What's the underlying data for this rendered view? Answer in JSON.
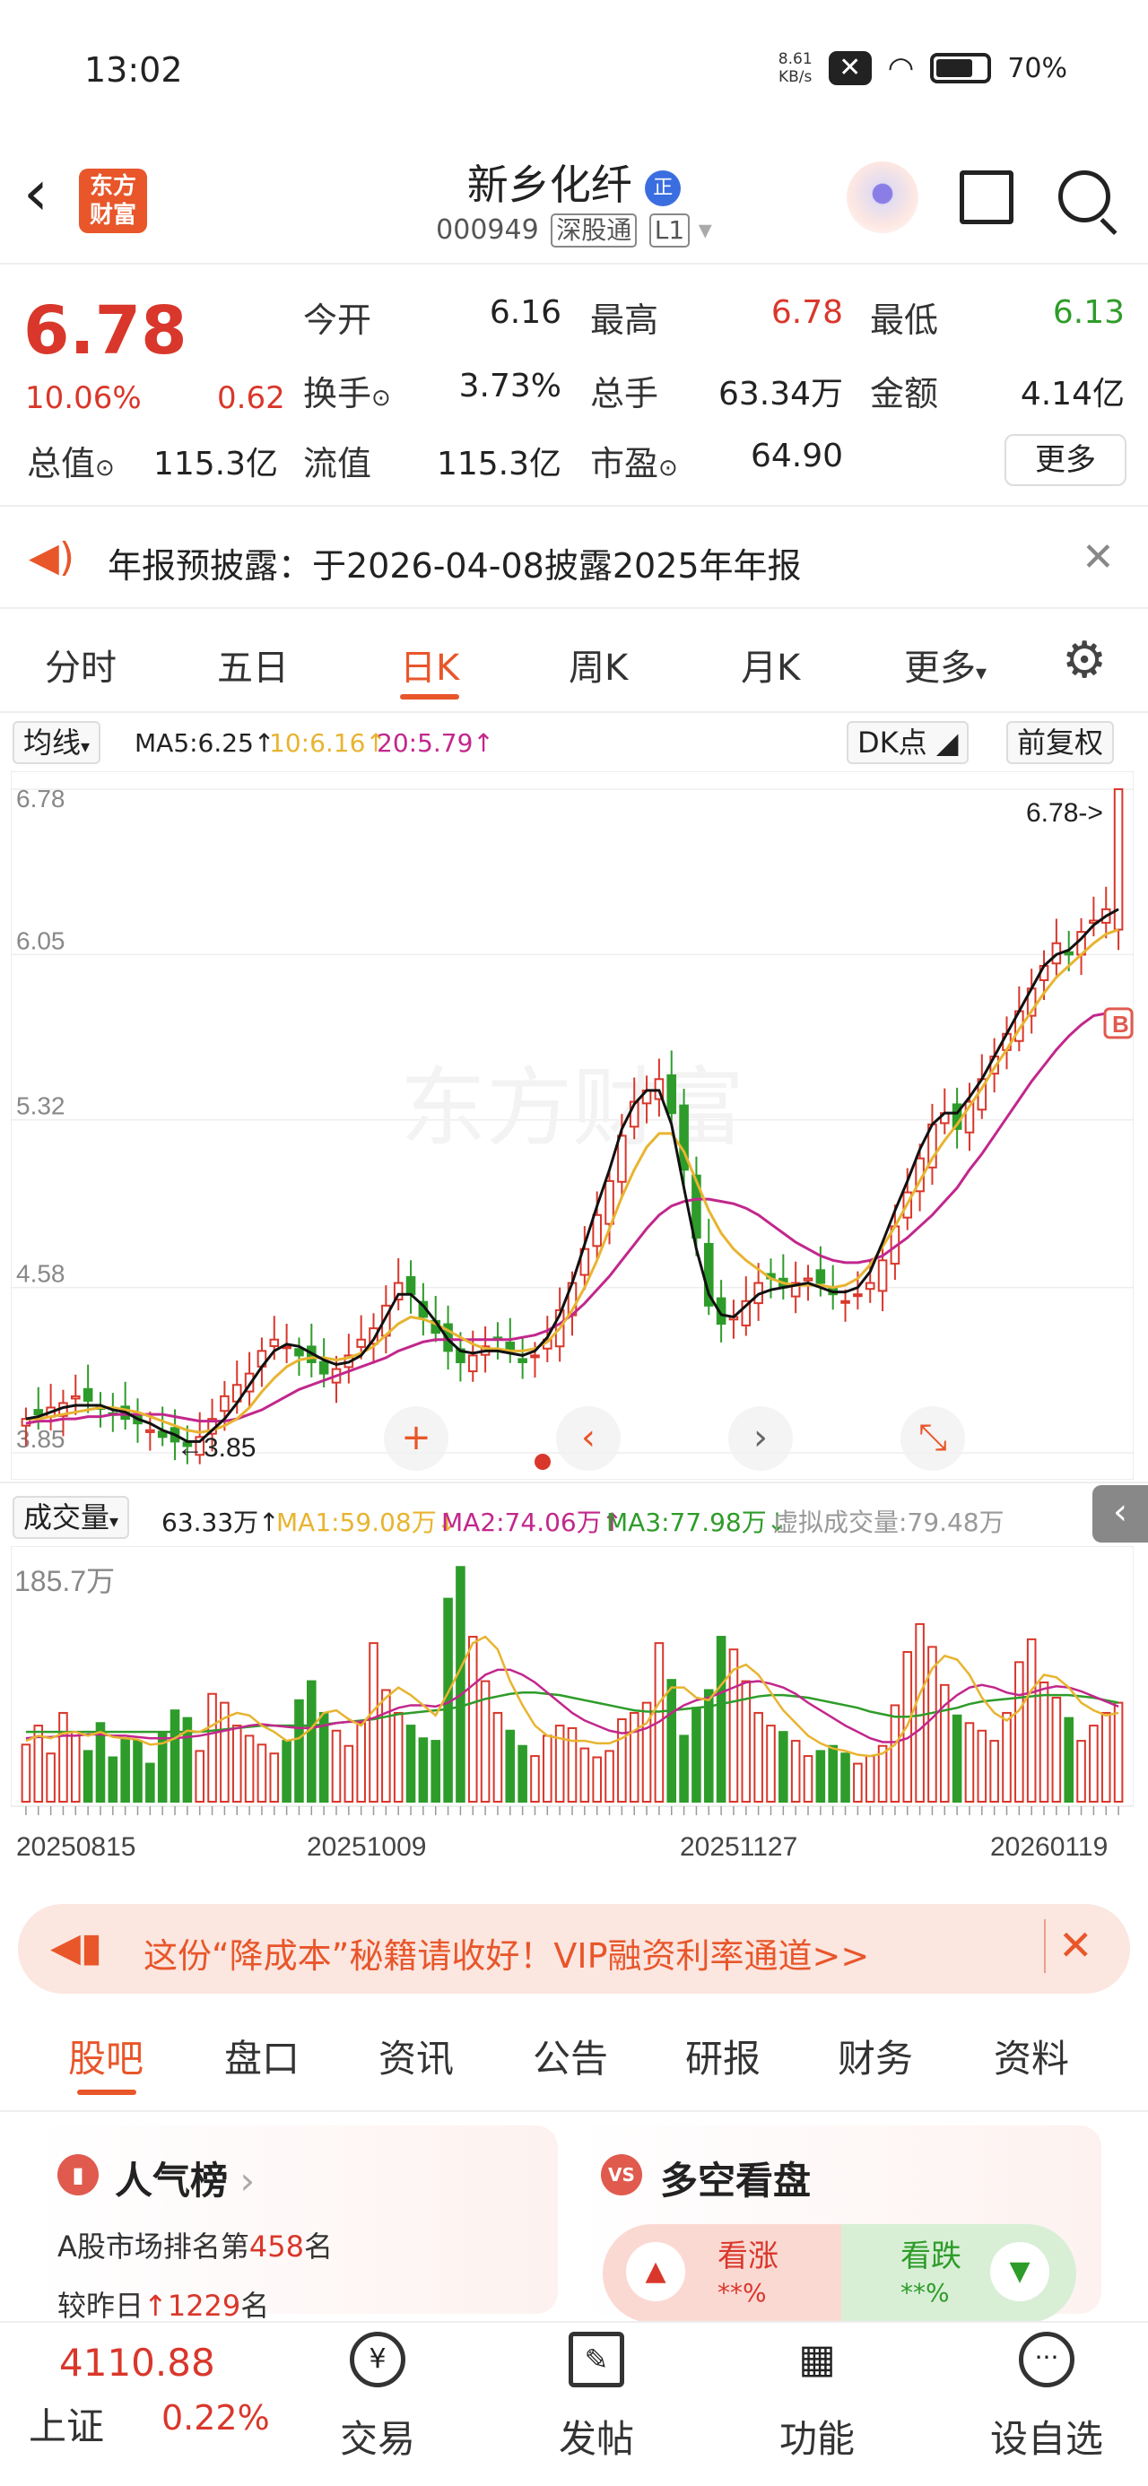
{
  "status_bar": {
    "time": "13:02",
    "net_speed": "8.61",
    "net_unit": "KB/s",
    "battery": "70%"
  },
  "header": {
    "logo": "东方财富",
    "name": "新乡化纤",
    "code": "000949",
    "tag1": "深股通",
    "tag2": "L1",
    "badge": "正"
  },
  "quote": {
    "price": "6.78",
    "pct": "10.06%",
    "change": "0.62",
    "open_label": "今开",
    "open": "6.16",
    "high_label": "最高",
    "high": "6.78",
    "low_label": "最低",
    "low": "6.13",
    "turnover_label": "换手",
    "turnover": "3.73%",
    "volume_label": "总手",
    "volume": "63.34万",
    "amount_label": "金额",
    "amount": "4.14亿",
    "mcap_label": "总值",
    "mcap": "115.3亿",
    "float_label": "流值",
    "float": "115.3亿",
    "pe_label": "市盈",
    "pe": "64.90",
    "more": "更多"
  },
  "notice": {
    "text": "年报预披露：于2026-04-08披露2025年年报"
  },
  "chart_tabs": [
    "分时",
    "五日",
    "日K",
    "周K",
    "月K",
    "更多"
  ],
  "ma_row": {
    "selector": "均线",
    "ma5": "MA5:6.25↑",
    "ma10": "10:6.16↑",
    "ma20": "20:5.79↑",
    "dk": "DK点",
    "adjust": "前复权"
  },
  "chart_data": {
    "type": "candlestick",
    "y_ticks": [
      "6.78",
      "6.05",
      "5.32",
      "4.58",
      "3.85"
    ],
    "ylim": [
      3.85,
      6.78
    ],
    "last_label": "6.78",
    "low_label": "3.85",
    "x_labels": [
      "20250815",
      "20251009",
      "20251127",
      "20260119"
    ],
    "closes": [
      4.0,
      4.02,
      4.05,
      4.07,
      4.1,
      4.08,
      4.05,
      4.02,
      4.0,
      3.98,
      3.95,
      3.92,
      3.9,
      3.88,
      3.92,
      4.0,
      4.1,
      4.15,
      4.2,
      4.3,
      4.35,
      4.32,
      4.28,
      4.25,
      4.2,
      4.22,
      4.28,
      4.35,
      4.4,
      4.5,
      4.6,
      4.55,
      4.45,
      4.38,
      4.3,
      4.25,
      4.28,
      4.32,
      4.35,
      4.3,
      4.25,
      4.28,
      4.35,
      4.48,
      4.6,
      4.75,
      4.9,
      5.05,
      5.25,
      5.4,
      5.45,
      5.5,
      5.35,
      5.1,
      4.8,
      4.5,
      4.42,
      4.45,
      4.52,
      4.6,
      4.62,
      4.58,
      4.6,
      4.62,
      4.6,
      4.55,
      4.52,
      4.55,
      4.6,
      4.7,
      4.85,
      5.0,
      5.15,
      5.3,
      5.35,
      5.28,
      5.4,
      5.5,
      5.6,
      5.7,
      5.8,
      5.9,
      6.0,
      6.1,
      6.05,
      6.15,
      6.2,
      6.25,
      6.78
    ],
    "ma5": [
      4.0,
      4.01,
      4.03,
      4.05,
      4.06,
      4.06,
      4.06,
      4.04,
      4.03,
      4.0,
      3.98,
      3.95,
      3.93,
      3.9,
      3.9,
      3.95,
      4.0,
      4.07,
      4.15,
      4.23,
      4.3,
      4.33,
      4.32,
      4.29,
      4.26,
      4.24,
      4.25,
      4.28,
      4.35,
      4.45,
      4.55,
      4.55,
      4.5,
      4.43,
      4.35,
      4.3,
      4.29,
      4.3,
      4.3,
      4.29,
      4.28,
      4.3,
      4.36,
      4.46,
      4.6,
      4.77,
      4.94,
      5.1,
      5.28,
      5.39,
      5.45,
      5.45,
      5.3,
      5.02,
      4.75,
      4.55,
      4.46,
      4.45,
      4.5,
      4.55,
      4.57,
      4.58,
      4.59,
      4.6,
      4.58,
      4.56,
      4.56,
      4.58,
      4.65,
      4.78,
      4.92,
      5.05,
      5.19,
      5.3,
      5.35,
      5.35,
      5.42,
      5.5,
      5.6,
      5.7,
      5.8,
      5.9,
      6.0,
      6.05,
      6.07,
      6.12,
      6.18,
      6.22,
      6.25
    ],
    "ma10": [
      4.0,
      4.0,
      4.01,
      4.02,
      4.03,
      4.04,
      4.05,
      4.05,
      4.04,
      4.03,
      4.01,
      3.99,
      3.97,
      3.95,
      3.94,
      3.95,
      3.97,
      4.0,
      4.05,
      4.12,
      4.18,
      4.23,
      4.26,
      4.27,
      4.27,
      4.26,
      4.27,
      4.29,
      4.32,
      4.37,
      4.42,
      4.45,
      4.44,
      4.42,
      4.39,
      4.36,
      4.33,
      4.31,
      4.31,
      4.3,
      4.3,
      4.31,
      4.34,
      4.4,
      4.48,
      4.58,
      4.7,
      4.84,
      4.98,
      5.1,
      5.2,
      5.26,
      5.26,
      5.18,
      5.05,
      4.92,
      4.82,
      4.75,
      4.7,
      4.66,
      4.62,
      4.6,
      4.59,
      4.59,
      4.59,
      4.58,
      4.59,
      4.62,
      4.68,
      4.76,
      4.85,
      4.95,
      5.05,
      5.15,
      5.23,
      5.3,
      5.38,
      5.46,
      5.55,
      5.63,
      5.72,
      5.8,
      5.88,
      5.95,
      6.0,
      6.05,
      6.1,
      6.14,
      6.16
    ],
    "ma20": [
      3.98,
      3.99,
      3.99,
      4.0,
      4.0,
      4.01,
      4.01,
      4.02,
      4.02,
      4.02,
      4.02,
      4.02,
      4.01,
      4.0,
      3.99,
      3.99,
      3.99,
      4.0,
      4.02,
      4.04,
      4.07,
      4.1,
      4.13,
      4.15,
      4.17,
      4.19,
      4.21,
      4.23,
      4.25,
      4.27,
      4.3,
      4.32,
      4.34,
      4.35,
      4.35,
      4.35,
      4.35,
      4.35,
      4.35,
      4.35,
      4.36,
      4.37,
      4.39,
      4.42,
      4.46,
      4.51,
      4.57,
      4.63,
      4.7,
      4.77,
      4.84,
      4.9,
      4.94,
      4.96,
      4.97,
      4.97,
      4.96,
      4.95,
      4.93,
      4.9,
      4.86,
      4.82,
      4.78,
      4.75,
      4.72,
      4.7,
      4.69,
      4.69,
      4.7,
      4.72,
      4.76,
      4.8,
      4.85,
      4.9,
      4.96,
      5.02,
      5.1,
      5.17,
      5.25,
      5.33,
      5.41,
      5.49,
      5.56,
      5.63,
      5.69,
      5.74,
      5.78,
      5.79,
      5.79
    ],
    "vol_max_label": "185.7万",
    "volumes": [
      45,
      60,
      38,
      70,
      55,
      40,
      62,
      35,
      50,
      48,
      30,
      55,
      72,
      66,
      40,
      85,
      78,
      60,
      52,
      45,
      38,
      48,
      80,
      95,
      70,
      56,
      44,
      62,
      125,
      88,
      70,
      60,
      50,
      48,
      160,
      185,
      130,
      95,
      70,
      56,
      44,
      36,
      52,
      60,
      58,
      42,
      35,
      40,
      65,
      70,
      78,
      125,
      96,
      52,
      74,
      88,
      130,
      120,
      95,
      70,
      60,
      55,
      48,
      36,
      40,
      44,
      38,
      30,
      36,
      44,
      76,
      118,
      140,
      122,
      92,
      68,
      62,
      56,
      48,
      70,
      110,
      128,
      94,
      82,
      66,
      48,
      60,
      70,
      78
    ],
    "vol_ma1": [
      48,
      52,
      50,
      54,
      55,
      52,
      55,
      51,
      50,
      49,
      45,
      46,
      50,
      56,
      55,
      60,
      66,
      70,
      68,
      60,
      55,
      48,
      50,
      58,
      70,
      72,
      65,
      60,
      72,
      82,
      90,
      84,
      76,
      68,
      86,
      105,
      125,
      130,
      120,
      95,
      76,
      60,
      52,
      50,
      48,
      48,
      46,
      46,
      50,
      56,
      62,
      78,
      90,
      90,
      82,
      80,
      92,
      104,
      108,
      100,
      86,
      72,
      62,
      52,
      46,
      42,
      40,
      37,
      36,
      38,
      45,
      60,
      85,
      105,
      115,
      112,
      100,
      82,
      70,
      64,
      72,
      88,
      100,
      98,
      90,
      78,
      72,
      68,
      70
    ],
    "vol_ma2": [
      50,
      51,
      51,
      52,
      52,
      53,
      53,
      52,
      52,
      51,
      50,
      50,
      50,
      51,
      52,
      54,
      56,
      58,
      60,
      61,
      60,
      59,
      58,
      58,
      60,
      62,
      63,
      63,
      66,
      70,
      74,
      76,
      76,
      75,
      78,
      84,
      92,
      100,
      104,
      104,
      100,
      94,
      86,
      78,
      70,
      64,
      60,
      56,
      54,
      55,
      58,
      63,
      70,
      76,
      80,
      82,
      86,
      90,
      94,
      95,
      93,
      90,
      85,
      78,
      72,
      66,
      60,
      55,
      50,
      47,
      47,
      50,
      57,
      66,
      76,
      84,
      90,
      92,
      90,
      86,
      84,
      86,
      89,
      91,
      90,
      87,
      83,
      79,
      75
    ],
    "vol_ma3": [
      55,
      55,
      55,
      55,
      55,
      55,
      55,
      55,
      55,
      55,
      55,
      55,
      55,
      55,
      55,
      56,
      57,
      58,
      59,
      60,
      60,
      60,
      60,
      60,
      61,
      62,
      63,
      64,
      65,
      67,
      69,
      70,
      71,
      72,
      73,
      75,
      78,
      81,
      83,
      85,
      86,
      86,
      85,
      84,
      82,
      80,
      78,
      76,
      74,
      72,
      71,
      71,
      72,
      73,
      74,
      75,
      77,
      79,
      81,
      83,
      84,
      84,
      83,
      82,
      80,
      78,
      76,
      74,
      71,
      69,
      67,
      67,
      68,
      70,
      72,
      74,
      77,
      79,
      80,
      81,
      82,
      83,
      84,
      84,
      84,
      83,
      82,
      80,
      78
    ]
  },
  "vol_row": {
    "selector": "成交量",
    "v": "63.33万↑",
    "ma1": "MA1:59.08万↓",
    "ma2": "MA2:74.06万↑",
    "ma3": "MA3:77.98万↓",
    "virtual": "虚拟成交量:79.48万"
  },
  "banner": {
    "text": "这份“降成本”秘籍请收好！VIP融资利率通道>>"
  },
  "bottom_tabs": [
    "股吧",
    "盘口",
    "资讯",
    "公告",
    "研报",
    "财务",
    "资料"
  ],
  "cards": {
    "left_title": "人气榜",
    "left_line1": "A股市场排名第",
    "left_rank": "458",
    "left_unit": "名",
    "left_line2": "较昨日",
    "left_delta": "1229",
    "left_unit2": "名",
    "right_title": "多空看盘",
    "up_label": "看涨",
    "down_label": "看跌",
    "up_val": "**%",
    "down_val": "**%"
  },
  "footer": {
    "index_value": "4110.88",
    "index_name": "上证",
    "index_pct": "0.22%",
    "items": [
      "交易",
      "发帖",
      "功能",
      "设自选"
    ]
  }
}
